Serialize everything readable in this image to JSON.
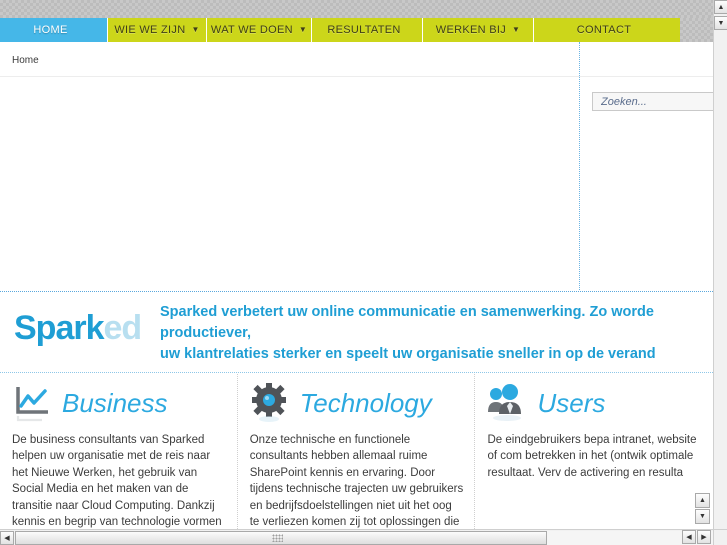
{
  "nav": {
    "items": [
      {
        "label": "HOME",
        "caret": "",
        "active": true
      },
      {
        "label": "WIE WE ZIJN",
        "caret": "▼",
        "active": false
      },
      {
        "label": "WAT WE DOEN",
        "caret": "▼",
        "active": false
      },
      {
        "label": "RESULTATEN",
        "caret": "",
        "active": false
      },
      {
        "label": "WERKEN BIJ",
        "caret": "▼",
        "active": false
      },
      {
        "label": "CONTACT",
        "caret": "",
        "active": false
      }
    ],
    "active_color": "#45b7e8",
    "base_color": "#ccd61a"
  },
  "breadcrumb": {
    "label": "Home"
  },
  "search": {
    "placeholder": "Zoeken...",
    "value": ""
  },
  "brand": {
    "logo_part1": "Spark",
    "logo_part2": "ed",
    "logo_color1": "#1f9ed4",
    "logo_color2": "#b8dff0"
  },
  "headline": {
    "line1": "Sparked verbetert uw online communicatie en samenwerking. Zo worde",
    "line2": "productiever,",
    "line3": "uw klantrelaties sterker en speelt uw organisatie sneller in op de verand",
    "color": "#1f9ed4"
  },
  "columns": [
    {
      "icon": "chart-icon",
      "title": "Business",
      "body": "De business consultants van Sparked helpen uw organisatie met de reis naar het Nieuwe Werken, het gebruik van Social Media en het maken van de transitie naar Cloud Computing. Dankzij kennis en begrip van technologie vormen zij de schakel tussen Business en IT."
    },
    {
      "icon": "gear-icon",
      "title": "Technology",
      "body": "Onze technische en functionele consultants hebben allemaal ruime SharePoint kennis en ervaring. Door tijdens technische trajecten uw gebruikers en bedrijfsdoelstellingen niet uit het oog te verliezen komen zij tot oplossingen die impact hebben."
    },
    {
      "icon": "users-icon",
      "title": "Users",
      "body": "De eindgebruikers bepa intranet, website of com betrekken in het (ontwik optimale resultaat. Verv de activering en resulta"
    }
  ],
  "scrollbars": {
    "up_arrow": "▲",
    "down_arrow": "▼",
    "left_arrow": "◀",
    "right_arrow": "▶"
  }
}
